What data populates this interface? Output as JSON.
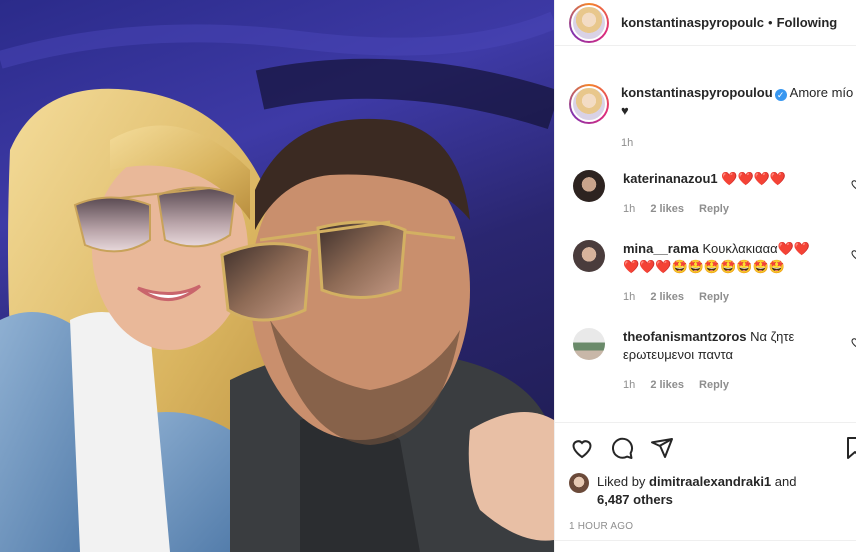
{
  "post": {
    "author": "konstantinaspyropoulou",
    "header_username": "konstantinaspyropoulc",
    "dot": "•",
    "follow_state": "Following"
  },
  "caption": {
    "username": "konstantinaspyropoulou",
    "verified": "✓",
    "text": "Amore mío ♥",
    "time": "1h"
  },
  "comments": [
    {
      "username": "katerinanazou1",
      "text": "❤️❤️❤️❤️",
      "time": "1h",
      "likes": "2 likes",
      "reply": "Reply"
    },
    {
      "username": "mina__rama",
      "text": "Κουκλακιααα❤️❤️❤️❤️❤️🤩🤩🤩🤩🤩🤩🤩",
      "time": "1h",
      "likes": "2 likes",
      "reply": "Reply"
    },
    {
      "username": "theofanismantzoros",
      "text": "Να ζητε ερωτευμενοι παντα",
      "time": "1h",
      "likes": "2 likes",
      "reply": "Reply"
    }
  ],
  "likes": {
    "prefix": "Liked by",
    "by": "dimitraalexandraki1",
    "and": "and",
    "others": "6,487 others"
  },
  "timestamp": "1 HOUR AGO",
  "icons": {
    "like": "heart-icon",
    "comment": "comment-icon",
    "share": "share-icon",
    "save": "bookmark-icon"
  }
}
